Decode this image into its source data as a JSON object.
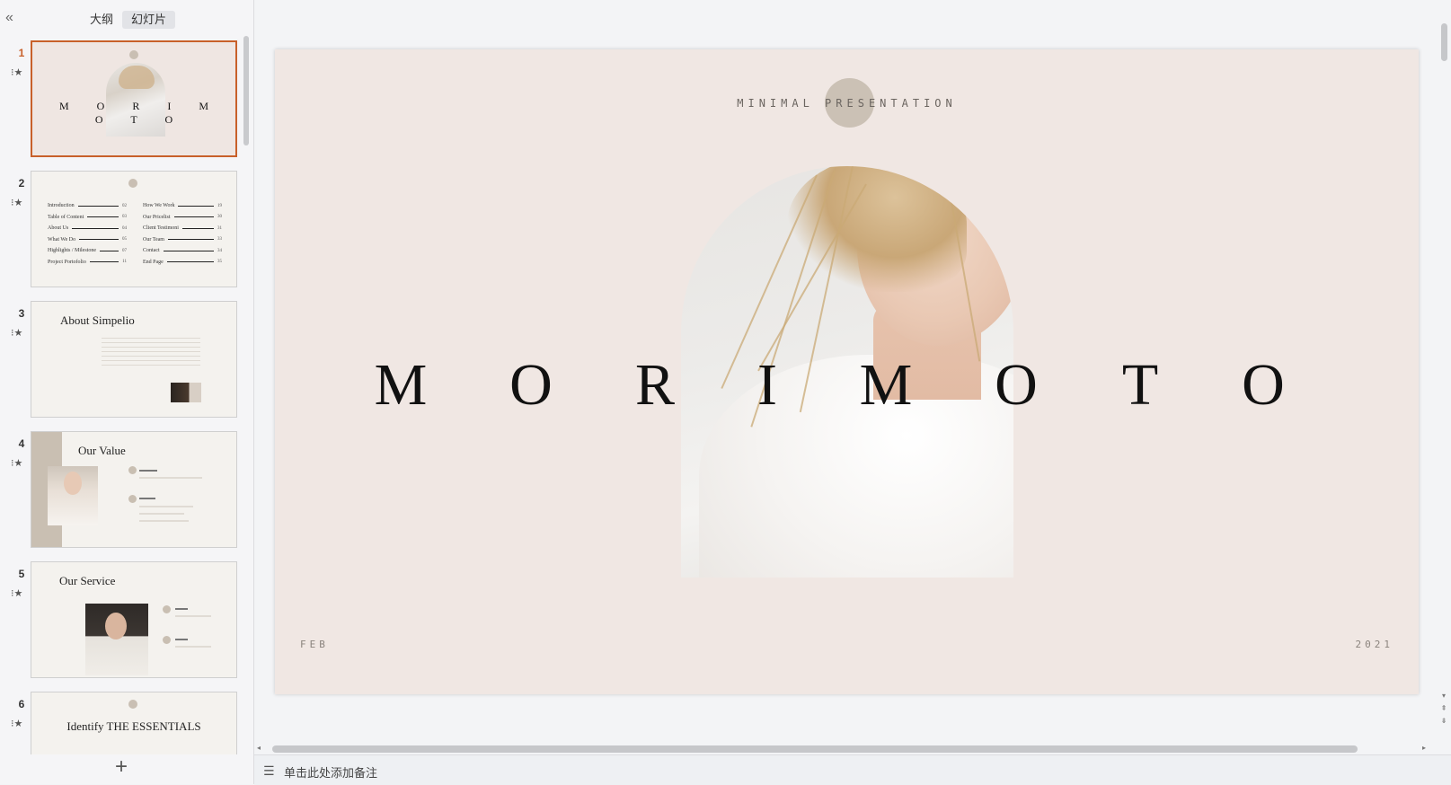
{
  "left_panel": {
    "collapse_glyph": "«",
    "tabs": [
      {
        "label": "大纲"
      },
      {
        "label": "幻灯片"
      }
    ],
    "add_glyph": "+",
    "slides": [
      {
        "number": "1",
        "title": "M O R I M O T O"
      },
      {
        "number": "2",
        "toc_left": [
          {
            "label": "Introduction",
            "page": "02"
          },
          {
            "label": "Table of Content",
            "page": "03"
          },
          {
            "label": "About Us",
            "page": "04"
          },
          {
            "label": "What We Do",
            "page": "05"
          },
          {
            "label": "Highlights / Milestone",
            "page": "07"
          },
          {
            "label": "Project Portofolio",
            "page": "11"
          }
        ],
        "toc_right": [
          {
            "label": "How We Work",
            "page": "19"
          },
          {
            "label": "Our Pricelist",
            "page": "30"
          },
          {
            "label": "Client Testimoni",
            "page": "31"
          },
          {
            "label": "Our Team",
            "page": "33"
          },
          {
            "label": "Contact",
            "page": "34"
          },
          {
            "label": "End Page",
            "page": "35"
          }
        ]
      },
      {
        "number": "3",
        "heading": "About Simpelio"
      },
      {
        "number": "4",
        "heading": "Our Value"
      },
      {
        "number": "5",
        "heading": "Our Service"
      },
      {
        "number": "6",
        "heading": "Identify THE ESSENTIALS"
      }
    ]
  },
  "main_slide": {
    "subtitle": "MINIMAL PRESENTATION",
    "title_letters": [
      "M",
      "O",
      "R",
      "I",
      "M",
      "O",
      "T",
      "O"
    ],
    "footer_left": "FEB",
    "footer_right": "2021"
  },
  "notes": {
    "placeholder": "单击此处添加备注"
  },
  "colors": {
    "accent": "#c8602a",
    "slide_background": "#f0e7e3"
  }
}
